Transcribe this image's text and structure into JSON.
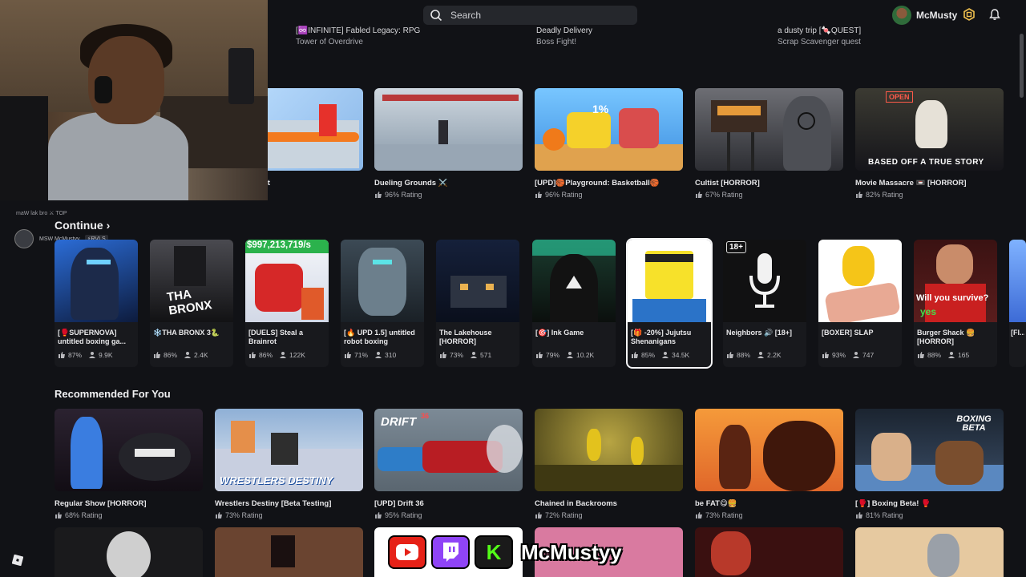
{
  "search": {
    "placeholder": "Search"
  },
  "user": {
    "name": "McMusty"
  },
  "top_games": [
    {
      "name": "[♾️INFINITE] Fabled Legacy: RPG",
      "sub": "Tower of Overdrive"
    },
    {
      "name": "Deadly Delivery",
      "sub": "Boss Fight!"
    },
    {
      "name": "a dusty trip [🍬QUEST]",
      "sub": "Scrap Scavenger quest"
    }
  ],
  "chat": {
    "line1": "maW lak bro    ⚔ TOP",
    "line2_name": "MSW McMustyy",
    "line2_badge": "⚡RVLS"
  },
  "row1": [
    {
      "name": "ot",
      "rating": ""
    },
    {
      "name": "Dueling Grounds ⚔️",
      "rating": "96% Rating"
    },
    {
      "name": "[UPD]🏀Playground: Basketball🏀",
      "rating": "96% Rating"
    },
    {
      "name": "Cultist [HORROR]",
      "rating": "67% Rating"
    },
    {
      "name": "Movie Massacre 📼 [HORROR]",
      "rating": "82% Rating"
    }
  ],
  "continue": {
    "title": "Continue",
    "items": [
      {
        "name": "[🥊SUPERNOVA] untitled boxing ga...",
        "rating": "87%",
        "players": "9.9K"
      },
      {
        "name": "❄️THA BRONX 3🐍",
        "rating": "86%",
        "players": "2.4K"
      },
      {
        "name": "[DUELS] Steal a Brainrot",
        "rating": "86%",
        "players": "122K"
      },
      {
        "name": "[🔥 UPD 1.5] untitled robot boxing",
        "rating": "71%",
        "players": "310"
      },
      {
        "name": "The Lakehouse [HORROR]",
        "rating": "73%",
        "players": "571"
      },
      {
        "name": "[🎯] Ink Game",
        "rating": "79%",
        "players": "10.2K"
      },
      {
        "name": "[🎁 -20%] Jujutsu Shenanigans",
        "rating": "85%",
        "players": "34.5K"
      },
      {
        "name": "Neighbors 🔊 [18+]",
        "rating": "88%",
        "players": "2.2K"
      },
      {
        "name": "[BOXER] SLAP",
        "rating": "93%",
        "players": "747"
      },
      {
        "name": "Burger Shack 🍔 [HORROR]",
        "rating": "88%",
        "players": "165"
      },
      {
        "name": "[FI... sch...",
        "rating": "",
        "players": ""
      }
    ]
  },
  "recommended": {
    "title": "Recommended For You",
    "items": [
      {
        "name": "Regular Show [HORROR]",
        "rating": "68% Rating"
      },
      {
        "name": "Wrestlers Destiny [Beta Testing]",
        "rating": "73% Rating"
      },
      {
        "name": "[UPD] Drift 36",
        "rating": "95% Rating"
      },
      {
        "name": "Chained in Backrooms",
        "rating": "72% Rating"
      },
      {
        "name": "be FAT😋🍔",
        "rating": "73% Rating"
      },
      {
        "name": "[🥊] Boxing Beta! 🥊",
        "rating": "81% Rating"
      }
    ]
  },
  "thumb_text": {
    "steal_price": "$997,213,719/s",
    "bronx": "THA BRONX",
    "lakehouse": "",
    "burger": "Will you survive?",
    "burger_yes": "yes",
    "movie": "BASED OFF A TRUE STORY",
    "movie_open": "OPEN",
    "drift": "DRIFT",
    "drift_num": "36",
    "wrestlers": "WRESTLERS DESTINY",
    "boxing": "BOXING BETA",
    "neighbors_badge": "18+",
    "percent": "1%"
  },
  "stream_overlay": {
    "handle": "McMustyy",
    "kick_letter": "K"
  }
}
